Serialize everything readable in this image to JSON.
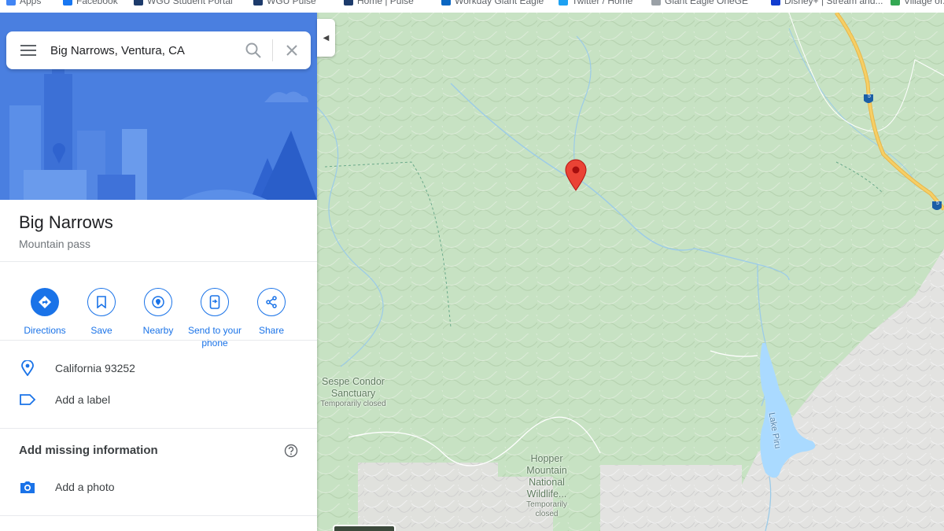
{
  "bookmarks": [
    {
      "label": "Apps",
      "color": "#4285f4"
    },
    {
      "label": "Facebook",
      "color": "#1877f2"
    },
    {
      "label": "WGU Student Portal",
      "color": "#1d3b6b"
    },
    {
      "label": "WGU Pulse",
      "color": "#1d3b6b"
    },
    {
      "label": "Home | Pulse",
      "color": "#1d3b6b"
    },
    {
      "label": "Workday Giant Eagle",
      "color": "#0a66c2"
    },
    {
      "label": "Twitter / Home",
      "color": "#1da1f2"
    },
    {
      "label": "Giant Eagle OneGE",
      "color": "#9aa0a6"
    },
    {
      "label": "Disney+ | Stream and...",
      "color": "#113ccf"
    },
    {
      "label": "Village of...",
      "color": "#34a853"
    }
  ],
  "search": {
    "query": "Big Narrows, Ventura, CA"
  },
  "place": {
    "title": "Big Narrows",
    "type": "Mountain pass"
  },
  "actions": [
    {
      "label": "Directions",
      "icon": "directions-icon"
    },
    {
      "label": "Save",
      "icon": "bookmark-icon"
    },
    {
      "label": "Nearby",
      "icon": "nearby-icon"
    },
    {
      "label": "Send to your phone",
      "icon": "phone-icon"
    },
    {
      "label": "Share",
      "icon": "share-icon"
    }
  ],
  "info": {
    "address": "California 93252",
    "label_prompt": "Add a label"
  },
  "missing": {
    "heading": "Add missing information",
    "photo_prompt": "Add a photo"
  },
  "map": {
    "labels": {
      "sespe_name": "Sespe Condor Sanctuary",
      "sespe_status": "Temporarily closed",
      "hopper_name": "Hopper Mountain National Wildlife...",
      "hopper_status": "Temporarily closed",
      "lake": "Lake Piru",
      "highway": "5"
    }
  },
  "colors": {
    "accent": "#1a73e8",
    "hero_bg": "#4a7fe0",
    "map_green": "#cfe5cc",
    "pin": "#ea4335",
    "water": "#aadaff",
    "highway": "#f6cf65"
  }
}
